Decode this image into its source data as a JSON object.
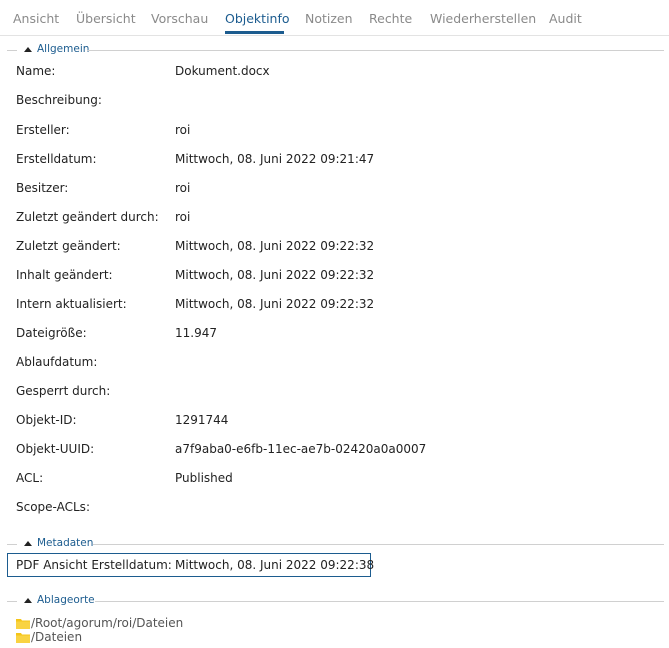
{
  "tabs": [
    {
      "label": "Ansicht"
    },
    {
      "label": "Übersicht"
    },
    {
      "label": "Vorschau"
    },
    {
      "label": "Objektinfo",
      "active": true
    },
    {
      "label": "Notizen"
    },
    {
      "label": "Rechte"
    },
    {
      "label": "Wiederherstellen"
    },
    {
      "label": "Audit"
    }
  ],
  "sections": {
    "allgemein": {
      "title": "Allgemein",
      "fields": [
        {
          "label": "Name:",
          "value": "Dokument.docx"
        },
        {
          "label": "Beschreibung:",
          "value": ""
        },
        {
          "label": "Ersteller:",
          "value": "roi"
        },
        {
          "label": "Erstelldatum:",
          "value": "Mittwoch, 08. Juni 2022 09:21:47"
        },
        {
          "label": "Besitzer:",
          "value": "roi"
        },
        {
          "label": "Zuletzt geändert durch:",
          "value": "roi"
        },
        {
          "label": "Zuletzt geändert:",
          "value": "Mittwoch, 08. Juni 2022 09:22:32"
        },
        {
          "label": "Inhalt geändert:",
          "value": "Mittwoch, 08. Juni 2022 09:22:32"
        },
        {
          "label": "Intern aktualisiert:",
          "value": "Mittwoch, 08. Juni 2022 09:22:32"
        },
        {
          "label": "Dateigröße:",
          "value": "11.947"
        },
        {
          "label": "Ablaufdatum:",
          "value": ""
        },
        {
          "label": "Gesperrt durch:",
          "value": ""
        },
        {
          "label": "Objekt-ID:",
          "value": "1291744"
        },
        {
          "label": "Objekt-UUID:",
          "value": "a7f9aba0-e6fb-11ec-ae7b-02420a0a0007"
        },
        {
          "label": "ACL:",
          "value": "Published"
        },
        {
          "label": "Scope-ACLs:",
          "value": ""
        }
      ]
    },
    "metadaten": {
      "title": "Metadaten",
      "fields": [
        {
          "label": "PDF Ansicht Erstelldatum:",
          "value": "Mittwoch, 08. Juni 2022 09:22:38"
        }
      ]
    },
    "ablageorte": {
      "title": "Ablageorte",
      "paths": [
        {
          "text": "/Root/agorum/roi/Dateien",
          "icon": "folder-icon"
        },
        {
          "text": "/Dateien",
          "icon": "folder-icon"
        }
      ]
    }
  },
  "colors": {
    "accent": "#1c5c8f",
    "tab_inactive": "#8a8a8a",
    "folder": "#f5c518"
  }
}
